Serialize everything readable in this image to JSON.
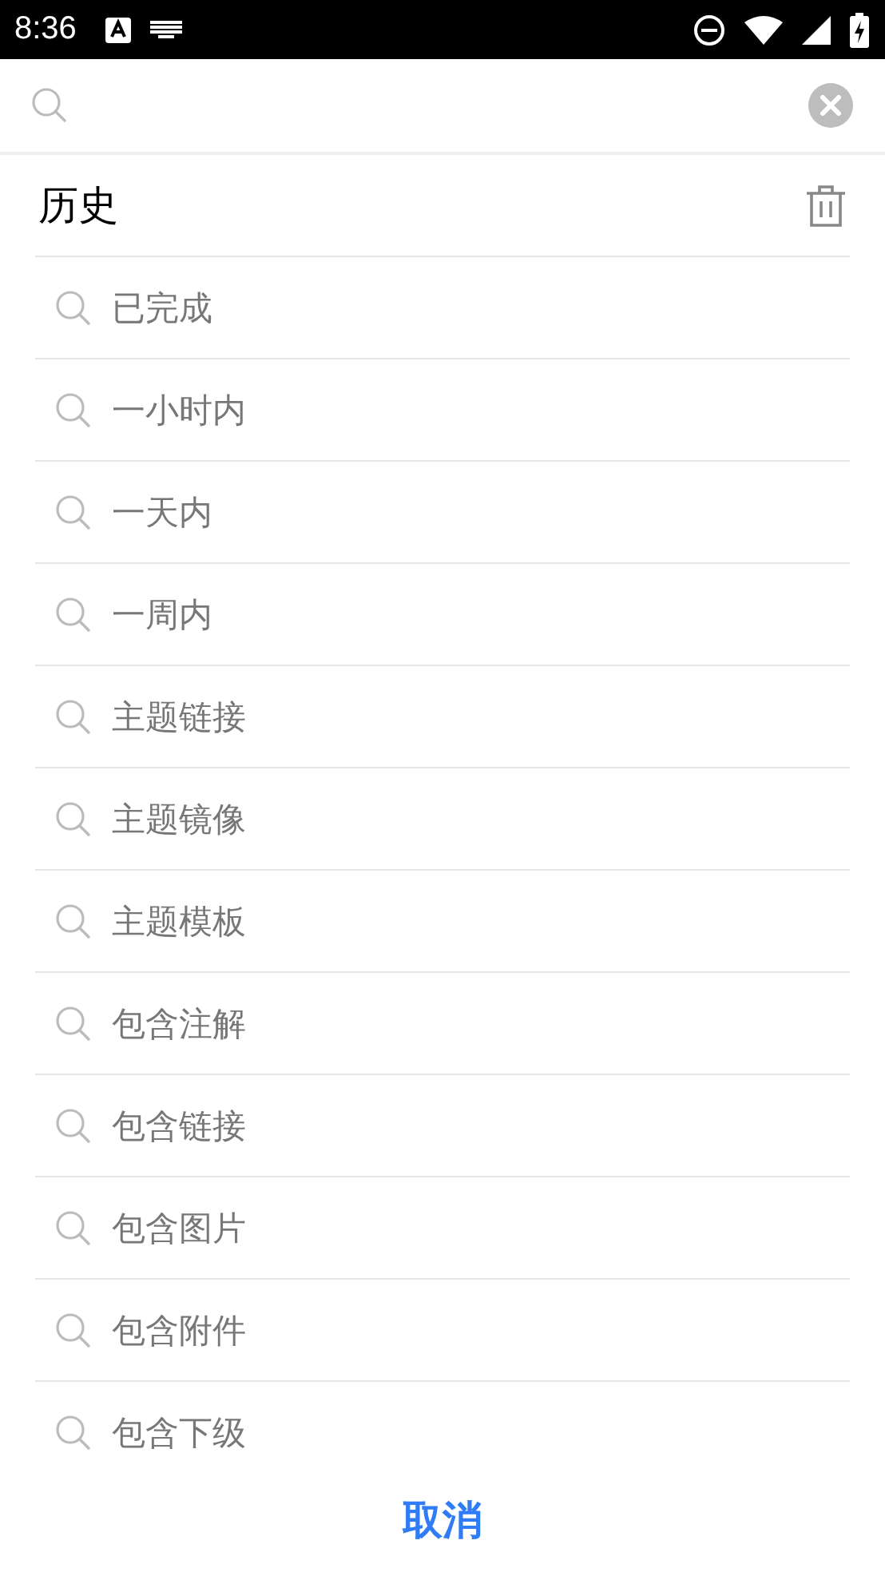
{
  "status_bar": {
    "time": "8:36"
  },
  "history": {
    "title": "历史",
    "items": [
      {
        "label": "已完成"
      },
      {
        "label": "一小时内"
      },
      {
        "label": "一天内"
      },
      {
        "label": "一周内"
      },
      {
        "label": "主题链接"
      },
      {
        "label": "主题镜像"
      },
      {
        "label": "主题模板"
      },
      {
        "label": "包含注解"
      },
      {
        "label": "包含链接"
      },
      {
        "label": "包含图片"
      },
      {
        "label": "包含附件"
      },
      {
        "label": "包含下级"
      }
    ]
  },
  "cancel_button": "取消"
}
